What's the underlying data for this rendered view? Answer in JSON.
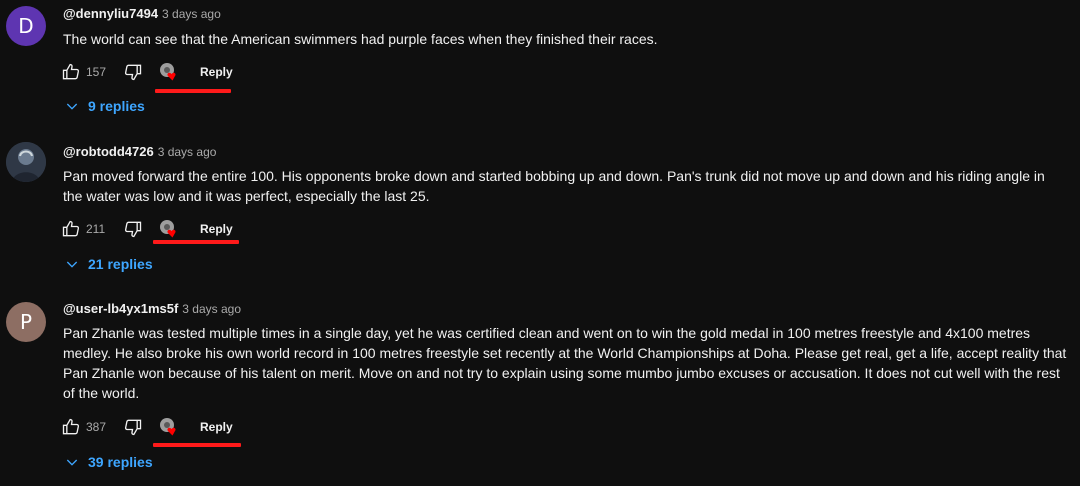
{
  "comments": [
    {
      "avatar_letter": "D",
      "avatar_color": "#5e35b1",
      "handle": "@dennyliu7494",
      "time": "3 days ago",
      "text": "The world can see that the American swimmers had purple faces when they finished their races.",
      "likes": "157",
      "reply_label": "Reply",
      "replies_label": "9 replies"
    },
    {
      "avatar_letter": "",
      "avatar_color": "#3a4352",
      "handle": "@robtodd4726",
      "time": "3 days ago",
      "text": "Pan moved forward the entire 100. His opponents broke down and started bobbing up and down. Pan's trunk did not move up and down and his riding angle in the water was low and it was perfect, especially the last 25.",
      "likes": "211",
      "reply_label": "Reply",
      "replies_label": "21 replies"
    },
    {
      "avatar_letter": "P",
      "avatar_color": "#8d6e63",
      "handle": "@user-lb4yx1ms5f",
      "time": "3 days ago",
      "text": "Pan Zhanle was tested multiple times in a single day, yet he was certified clean and went on to win the gold medal in 100 metres freestyle and 4x100 metres medley. He also broke his own world record in 100 metres freestyle set recently at the World Championships at Doha. Please get real, get a life, accept reality that Pan Zhanle won because of his talent on merit. Move on and not try to explain using some mumbo jumbo excuses or accusation. It does not cut well with the rest of the world.",
      "likes": "387",
      "reply_label": "Reply",
      "replies_label": "39 replies"
    }
  ],
  "colors": {
    "background": "#0f0f0f",
    "link": "#3ea6ff",
    "annotation": "#ff1a1a"
  },
  "icons": [
    "thumbs-up-icon",
    "thumbs-down-icon",
    "creator-heart-icon",
    "chevron-down-icon"
  ]
}
